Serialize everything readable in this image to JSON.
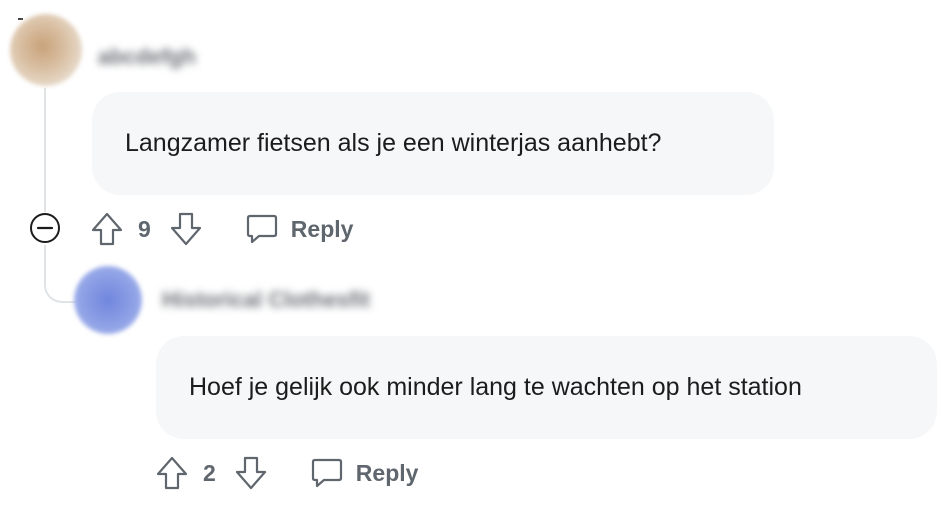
{
  "comments": [
    {
      "username": "abcdefgh",
      "text": "Langzamer fietsen als je een winterjas aanhebt?",
      "votes": "9",
      "reply_label": "Reply",
      "icons": [
        "upvote-arrow-icon",
        "downvote-arrow-icon",
        "speech-bubble-icon",
        "minus-circle-icon"
      ]
    },
    {
      "username": "Historical Clothesfit",
      "text": "Hoef je gelijk ook minder lang te wachten op het station",
      "votes": "2",
      "reply_label": "Reply",
      "icons": [
        "upvote-arrow-icon",
        "downvote-arrow-icon",
        "speech-bubble-icon"
      ]
    }
  ],
  "colors": {
    "bubble_bg": "#f6f7f8",
    "action_text": "#5f666d",
    "thread_line": "#dfe3e6"
  }
}
